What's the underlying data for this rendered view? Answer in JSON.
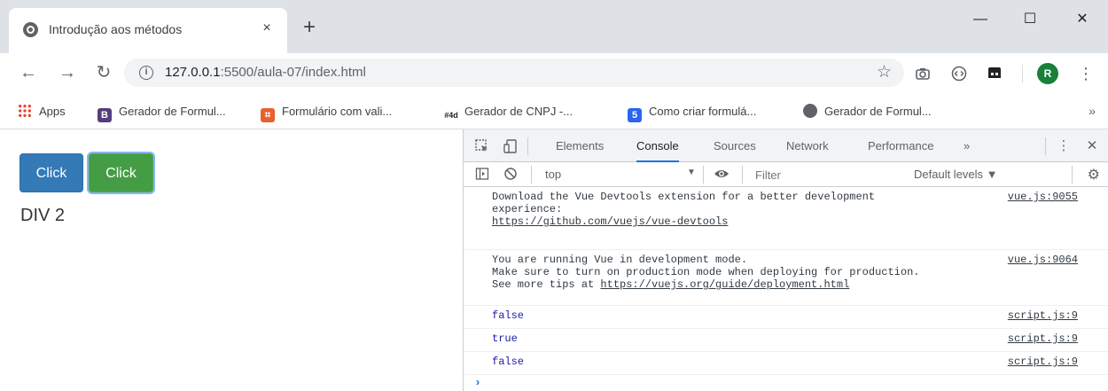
{
  "browser": {
    "tab_title": "Introdução aos métodos",
    "tab_close": "×",
    "new_tab": "+",
    "window_minimize": "—",
    "window_maximize": "☐",
    "window_close": "✕",
    "url_host": "127.0.0.1",
    "url_path": ":5500/aula-07/index.html",
    "avatar_letter": "R"
  },
  "bookmarks": [
    {
      "label": "Apps",
      "icon": "apps-grid-icon"
    },
    {
      "label": "Gerador de Formul...",
      "icon": "B",
      "color": "#563d7c"
    },
    {
      "label": "Formulário com vali...",
      "icon": "⌗",
      "color": "#e8612c"
    },
    {
      "label": "Gerador de CNPJ -...",
      "icon": "#4d",
      "color": "#222222"
    },
    {
      "label": "Como criar formulá...",
      "icon": "5",
      "color": "#2965f1"
    },
    {
      "label": "Gerador de Formul...",
      "icon": "circle-icon",
      "color": "#5f6368"
    }
  ],
  "page": {
    "button1": "Click",
    "button2": "Click",
    "div_text": "DIV 2"
  },
  "devtools": {
    "tabs": [
      "Elements",
      "Console",
      "Sources",
      "Network",
      "Performance"
    ],
    "active_tab": "Console",
    "more_tabs": "»",
    "context": "top",
    "filter_placeholder": "Filter",
    "levels": "Default levels ▼",
    "messages": [
      {
        "lines": [
          "Download the Vue Devtools extension for a better development",
          "experience:",
          "https://github.com/vuejs/vue-devtools"
        ],
        "source": "vue.js:9055"
      },
      {
        "lines": [
          "You are running Vue in development mode.",
          "Make sure to turn on production mode when deploying for production.",
          "See more tips at https://vuejs.org/guide/deployment.html"
        ],
        "source": "vue.js:9064"
      },
      {
        "lines": [
          "false"
        ],
        "source": "script.js:9"
      },
      {
        "lines": [
          "true"
        ],
        "source": "script.js:9"
      },
      {
        "lines": [
          "false"
        ],
        "source": "script.js:9"
      }
    ],
    "prompt": "›"
  }
}
